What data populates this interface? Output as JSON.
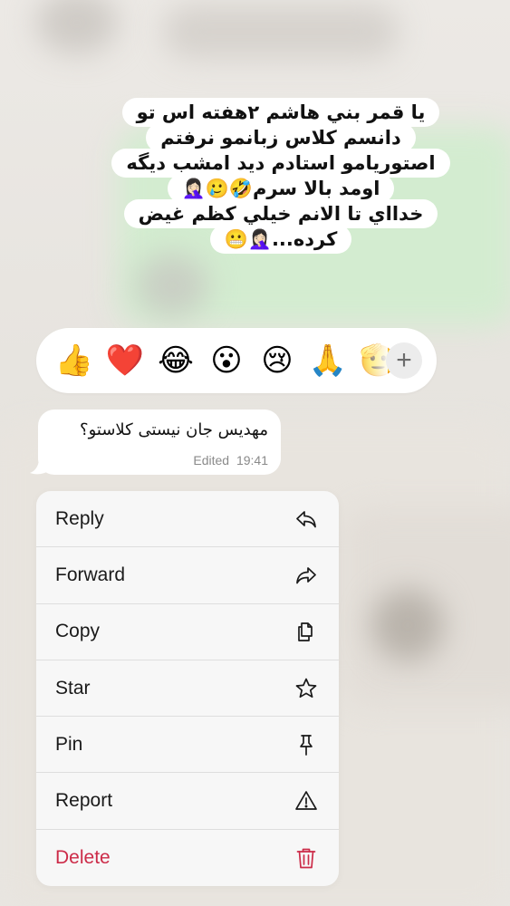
{
  "caption": {
    "lines": [
      "يا قمر بني هاشم ۲هفته اس تو",
      "دانسم کلاس زبانمو نرفتم",
      "اصتوریامو استادم دید امشب دیگه",
      "اومد بالا سرم🤣🥲🤦🏻‍♀️",
      "خدااي تا الانم خيلي كظم غيض",
      "کرده...🤦🏻‍♀️😬"
    ]
  },
  "reactions": {
    "items": [
      {
        "emoji": "👍",
        "name": "thumbs-up"
      },
      {
        "emoji": "❤️",
        "name": "red-heart"
      },
      {
        "emoji": "😂",
        "name": "tears-of-joy"
      },
      {
        "emoji": "😮",
        "name": "surprised-face"
      },
      {
        "emoji": "😢",
        "name": "crying-face"
      },
      {
        "emoji": "🙏",
        "name": "folded-hands"
      },
      {
        "emoji": "🫡",
        "name": "saluting-face"
      }
    ],
    "more_label": "+"
  },
  "message": {
    "text": "مهدیس جان نیستی کلاستو؟",
    "edited_label": "Edited",
    "time": "19:41"
  },
  "menu": {
    "items": [
      {
        "label": "Reply",
        "icon": "reply-icon"
      },
      {
        "label": "Forward",
        "icon": "forward-icon"
      },
      {
        "label": "Copy",
        "icon": "copy-icon"
      },
      {
        "label": "Star",
        "icon": "star-icon"
      },
      {
        "label": "Pin",
        "icon": "pin-icon"
      },
      {
        "label": "Report",
        "icon": "report-icon"
      },
      {
        "label": "Delete",
        "icon": "trash-icon"
      }
    ]
  },
  "colors": {
    "danger": "#cc2b48",
    "menu_background": "#f7f7f7",
    "bubble_background": "#ffffff"
  }
}
